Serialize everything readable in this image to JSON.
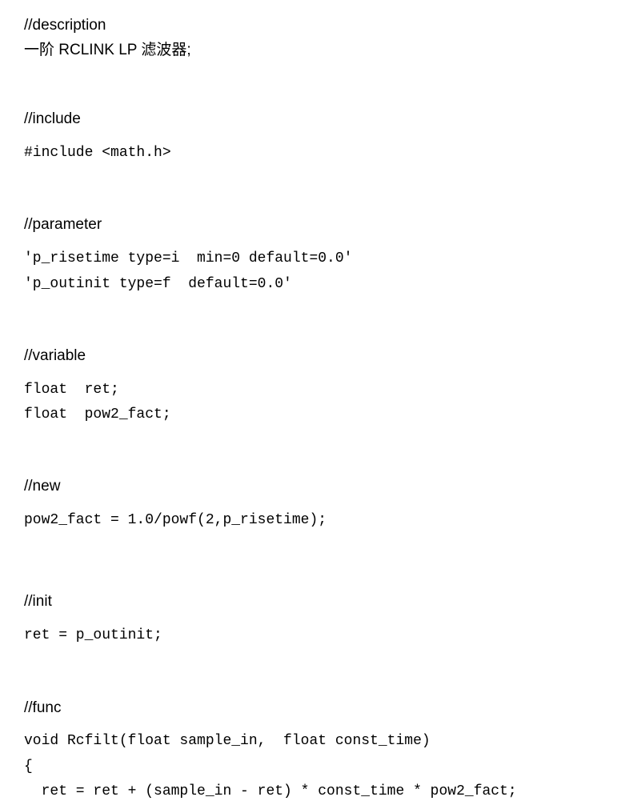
{
  "sections": {
    "description": {
      "heading": "//description",
      "text": "一阶 RCLINK LP  滤波器;"
    },
    "include": {
      "heading": "//include",
      "line0": "#include <math.h>"
    },
    "parameter": {
      "heading": "//parameter",
      "line0": "'p_risetime type=i  min=0 default=0.0'",
      "line1": "'p_outinit type=f  default=0.0'"
    },
    "variable": {
      "heading": "//variable",
      "line0": "float  ret;",
      "line1": "float  pow2_fact;"
    },
    "new": {
      "heading": "//new",
      "line0": "pow2_fact = 1.0/powf(2,p_risetime);"
    },
    "init": {
      "heading": "//init",
      "line0": "ret = p_outinit;"
    },
    "func": {
      "heading": "//func",
      "line0": "void Rcfilt(float sample_in,  float const_time)",
      "line1": "{",
      "line2": "  ret = ret + (sample_in - ret) * const_time * pow2_fact;"
    }
  }
}
